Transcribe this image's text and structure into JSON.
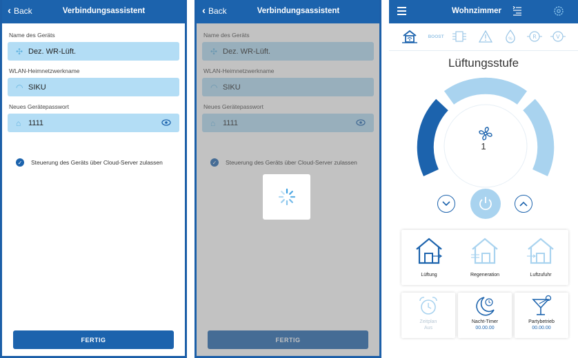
{
  "wizard": {
    "back": "Back",
    "title": "Verbindungsassistent",
    "device_name_label": "Name des Geräts",
    "device_name_value": "Dez. WR-Lüft.",
    "wlan_label": "WLAN-Heimnetzwerkname",
    "wlan_value": "SIKU",
    "password_label": "Neues Gerätepasswort",
    "password_value": "1111",
    "cloud_checkbox": "Steuerung des Geräts über Cloud-Server zulassen",
    "done_button": "FERTIG"
  },
  "main": {
    "room_title": "Wohnzimmer",
    "boost_label": "BOOST",
    "section_title": "Lüftungsstufe",
    "level": "1",
    "modes": [
      {
        "label": "Lüftung"
      },
      {
        "label": "Regeneration"
      },
      {
        "label": "Luftzufuhr"
      }
    ],
    "schedule": {
      "label": "Zeitplan",
      "value": "Aus"
    },
    "night_timer": {
      "label": "Nacht-Timer",
      "value": "00.00.00"
    },
    "party": {
      "label": "Partybetrieb",
      "value": "00.00.00"
    }
  }
}
